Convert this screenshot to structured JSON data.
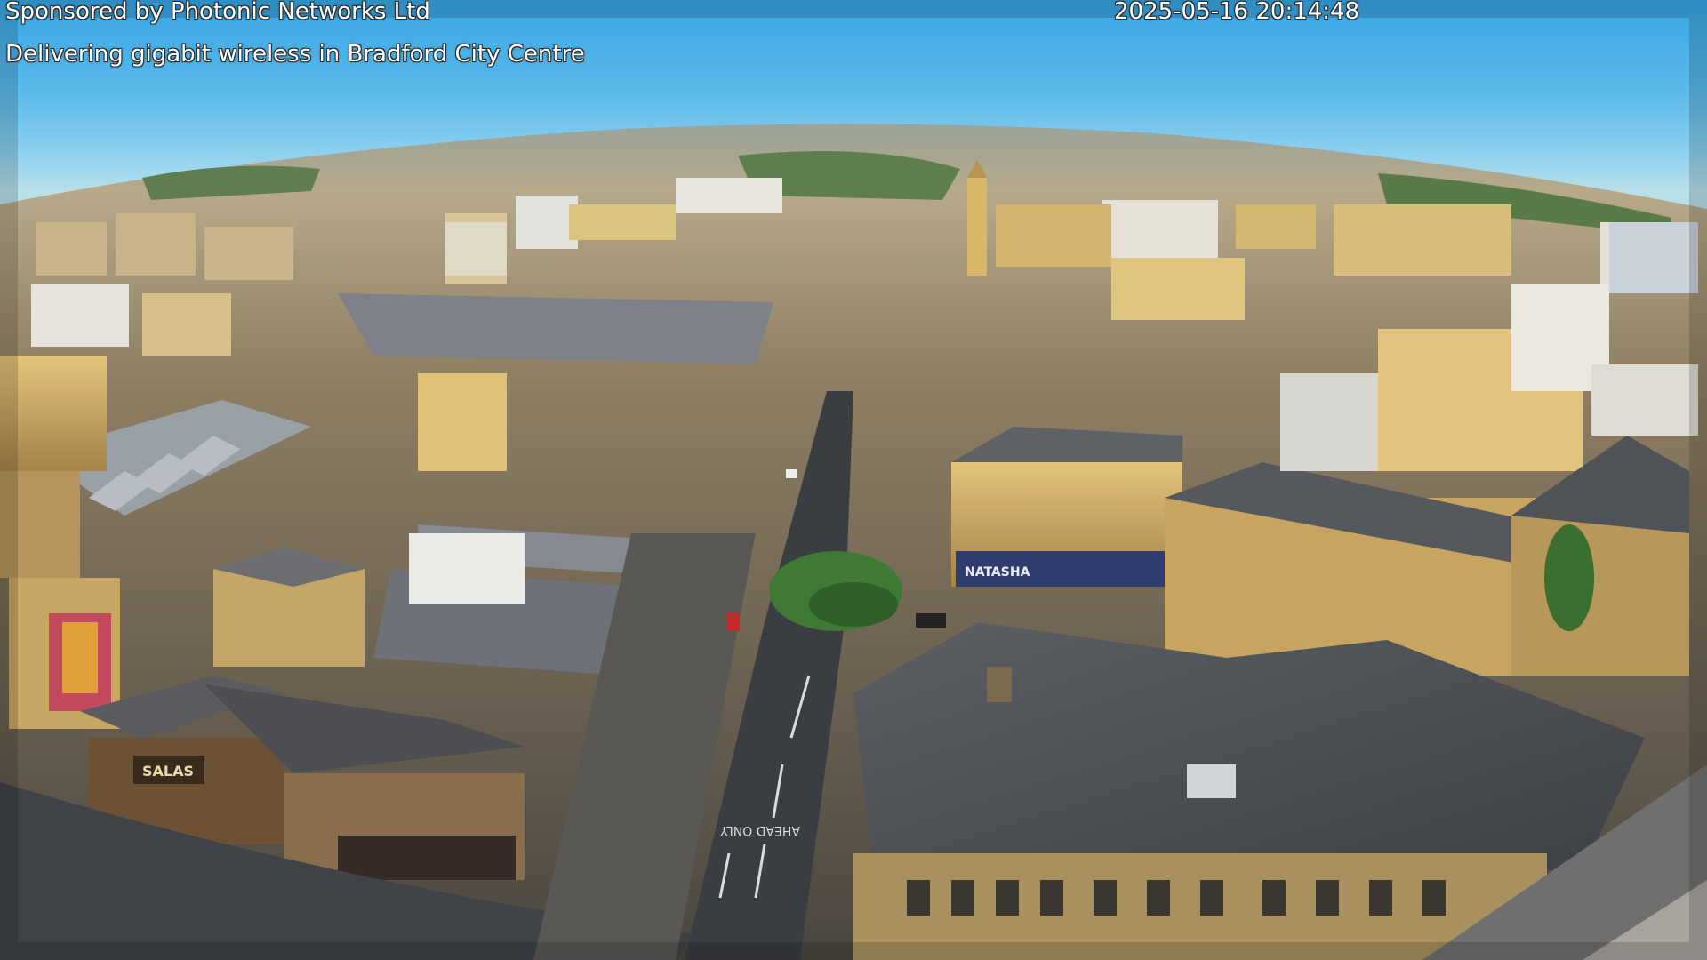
{
  "overlay": {
    "sponsor": "Sponsored by Photonic Networks Ltd",
    "tagline": "Delivering gigabit wireless in Bradford City Centre",
    "timestamp": "2025-05-16 20:14:48"
  },
  "signage": {
    "shop_left": "SALAS",
    "shop_center": "NATASHA",
    "road_marking": "AHEAD ONLY"
  },
  "colors": {
    "sky_top": "#38a6e4",
    "sky_horizon": "#b9dfe9",
    "sandstone_lit": "#d9b66a",
    "roof_slate": "#4a4d52",
    "road": "#3a3d42",
    "tree": "#3f7a34"
  }
}
